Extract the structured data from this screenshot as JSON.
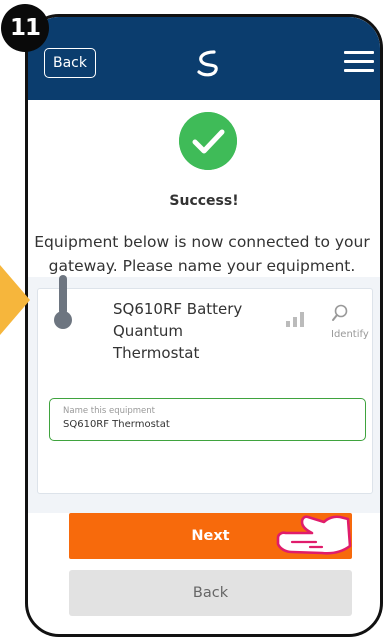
{
  "step": {
    "number": "11"
  },
  "header": {
    "back_label": "Back",
    "logo_icon": "s-logo-icon",
    "menu_icon": "hamburger-menu-icon",
    "bar_color": "#0b3d6e"
  },
  "status": {
    "icon": "check-circle-icon",
    "title": "Success!",
    "message": "Equipment below is now connected to your gateway. Please name your equipment."
  },
  "device": {
    "name": "SQ610RF Battery Quantum Thermostat",
    "icon": "thermometer-icon",
    "signal_icon": "signal-strength-icon",
    "identify_icon": "search-icon",
    "identify_label": "Identify"
  },
  "name_field": {
    "label": "Name this equipment",
    "value": "SQ610RF Thermostat"
  },
  "actions": {
    "next_label": "Next",
    "back_label": "Back",
    "next_color": "#f76a0c"
  },
  "colors": {
    "success": "#3fbb58",
    "field_border": "#3fa33e",
    "arrow": "#f6b63c"
  }
}
